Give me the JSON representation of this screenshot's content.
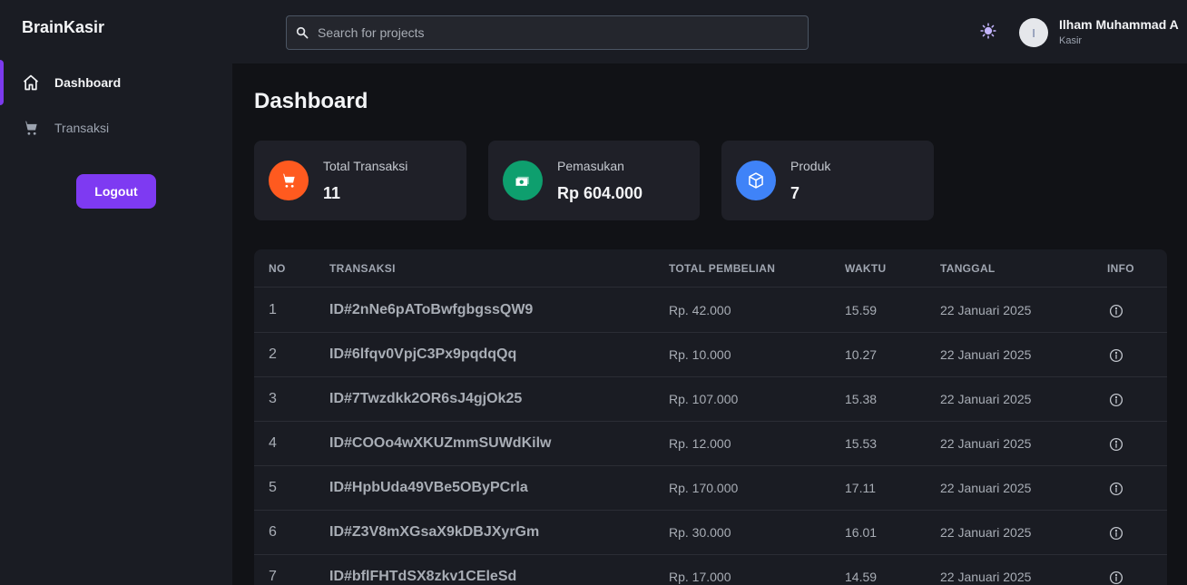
{
  "brand": "BrainKasir",
  "sidebar": {
    "items": [
      {
        "label": "Dashboard",
        "icon": "home-icon"
      },
      {
        "label": "Transaksi",
        "icon": "cart-icon"
      }
    ],
    "logout_label": "Logout"
  },
  "header": {
    "search_placeholder": "Search for projects",
    "theme_icon": "sun-icon",
    "avatar_initial": "I",
    "user_name": "Ilham Muhammad A",
    "user_role": "Kasir"
  },
  "main": {
    "title": "Dashboard",
    "cards": [
      {
        "label": "Total Transaksi",
        "value": "11",
        "icon": "cart-icon",
        "color": "#ff5a1f"
      },
      {
        "label": "Pemasukan",
        "value": "Rp 604.000",
        "icon": "money-icon",
        "color": "#0e9f6e"
      },
      {
        "label": "Produk",
        "value": "7",
        "icon": "box-icon",
        "color": "#3f83f8"
      }
    ],
    "table": {
      "headers": [
        "NO",
        "TRANSAKSI",
        "TOTAL PEMBELIAN",
        "WAKTU",
        "TANGGAL",
        "INFO"
      ],
      "rows": [
        {
          "no": "1",
          "id": "ID#2nNe6pAToBwfgbgssQW9",
          "total": "Rp. 42.000",
          "waktu": "15.59",
          "tanggal": "22 Januari 2025"
        },
        {
          "no": "2",
          "id": "ID#6lfqv0VpjC3Px9pqdqQq",
          "total": "Rp. 10.000",
          "waktu": "10.27",
          "tanggal": "22 Januari 2025"
        },
        {
          "no": "3",
          "id": "ID#7Twzdkk2OR6sJ4gjOk25",
          "total": "Rp. 107.000",
          "waktu": "15.38",
          "tanggal": "22 Januari 2025"
        },
        {
          "no": "4",
          "id": "ID#COOo4wXKUZmmSUWdKilw",
          "total": "Rp. 12.000",
          "waktu": "15.53",
          "tanggal": "22 Januari 2025"
        },
        {
          "no": "5",
          "id": "ID#HpbUda49VBe5OByPCrla",
          "total": "Rp. 170.000",
          "waktu": "17.11",
          "tanggal": "22 Januari 2025"
        },
        {
          "no": "6",
          "id": "ID#Z3V8mXGsaX9kDBJXyrGm",
          "total": "Rp. 30.000",
          "waktu": "16.01",
          "tanggal": "22 Januari 2025"
        },
        {
          "no": "7",
          "id": "ID#bflFHTdSX8zkv1CEleSd",
          "total": "Rp. 17.000",
          "waktu": "14.59",
          "tanggal": "22 Januari 2025"
        }
      ]
    }
  },
  "colors": {
    "accent": "#7e3af2",
    "sidebar_bg": "#1a1c23",
    "page_bg": "#111216"
  }
}
